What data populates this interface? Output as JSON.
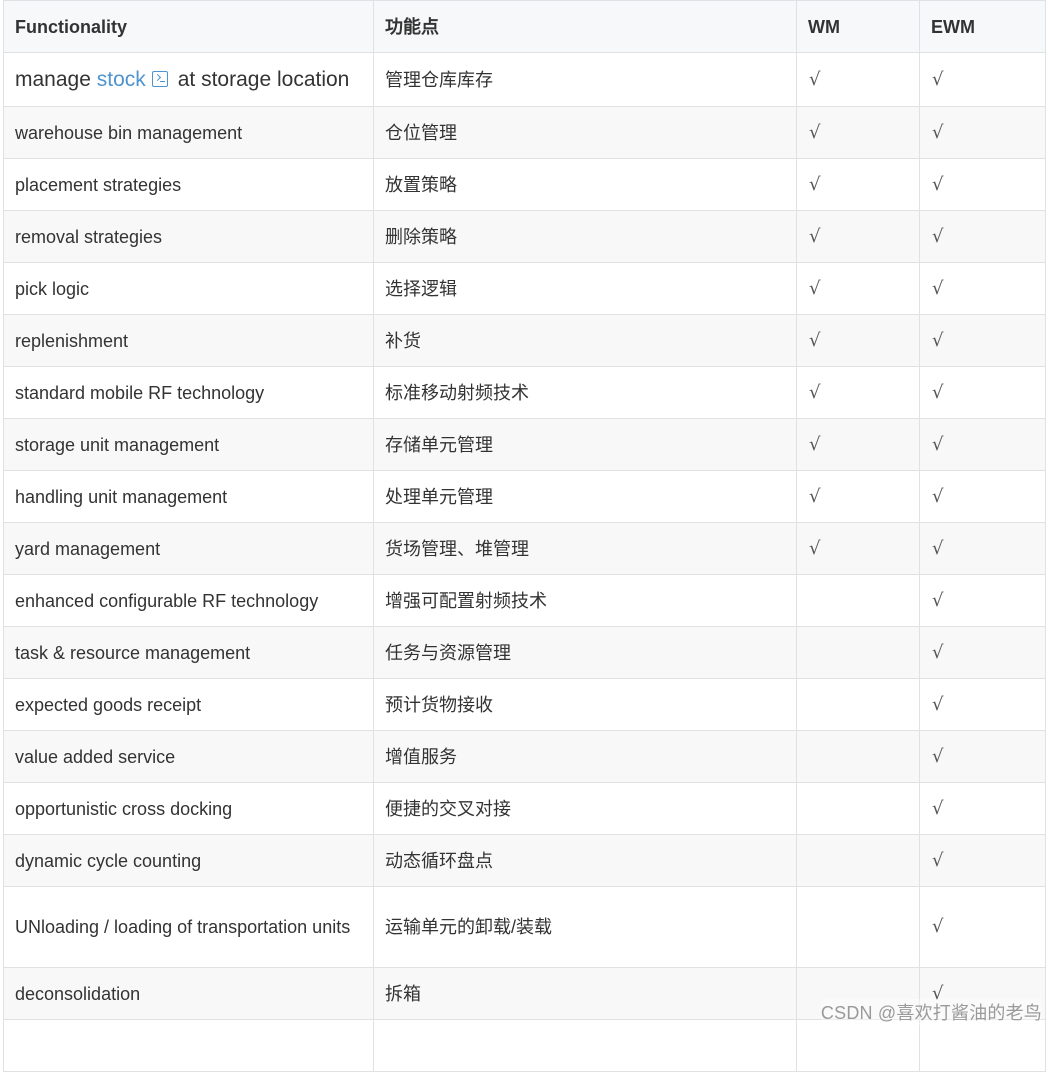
{
  "table": {
    "headers": [
      "Functionality",
      "功能点",
      "WM",
      "EWM"
    ],
    "first_row": {
      "func_before": "manage ",
      "func_link": "stock",
      "func_after": "at storage location",
      "zh": "管理仓库库存",
      "wm": "√",
      "ewm": "√"
    },
    "rows": [
      {
        "func": "warehouse bin management",
        "zh": "仓位管理",
        "wm": "√",
        "ewm": "√"
      },
      {
        "func": "placement strategies",
        "zh": "放置策略",
        "wm": "√",
        "ewm": "√"
      },
      {
        "func": "removal strategies",
        "zh": "删除策略",
        "wm": "√",
        "ewm": "√"
      },
      {
        "func": "pick logic",
        "zh": "选择逻辑",
        "wm": "√",
        "ewm": "√"
      },
      {
        "func": "replenishment",
        "zh": "补货",
        "wm": "√",
        "ewm": "√"
      },
      {
        "func": "standard mobile RF technology",
        "zh": "标准移动射频技术",
        "wm": "√",
        "ewm": "√"
      },
      {
        "func": "storage unit management",
        "zh": "存储单元管理",
        "wm": "√",
        "ewm": "√"
      },
      {
        "func": "handling unit management",
        "zh": "处理单元管理",
        "wm": "√",
        "ewm": "√"
      },
      {
        "func": "yard management",
        "zh": "货场管理、堆管理",
        "wm": "√",
        "ewm": "√"
      },
      {
        "func": "enhanced configurable RF technology",
        "zh": "增强可配置射频技术",
        "wm": "",
        "ewm": "√"
      },
      {
        "func": "task & resource management",
        "zh": "任务与资源管理",
        "wm": "",
        "ewm": "√"
      },
      {
        "func": "expected goods receipt",
        "zh": "预计货物接收",
        "wm": "",
        "ewm": "√"
      },
      {
        "func": "value added service",
        "zh": "增值服务",
        "wm": "",
        "ewm": "√"
      },
      {
        "func": "opportunistic cross docking",
        "zh": "便捷的交叉对接",
        "wm": "",
        "ewm": "√"
      },
      {
        "func": "dynamic cycle counting",
        "zh": "动态循环盘点",
        "wm": "",
        "ewm": "√"
      },
      {
        "func": "UNloading / loading of transportation units",
        "zh": "运输单元的卸载/装载",
        "wm": "",
        "ewm": "√",
        "tall": true
      },
      {
        "func": "deconsolidation",
        "zh": "拆箱",
        "wm": "",
        "ewm": "√"
      },
      {
        "func": "",
        "zh": "",
        "wm": "",
        "ewm": ""
      }
    ]
  },
  "watermark": "CSDN @喜欢打酱油的老鸟",
  "icons": {
    "inline_link_icon": "terminal-icon"
  },
  "colors": {
    "link": "#4e94ce",
    "header_bg": "#f6f8fa",
    "border": "#dfe2e5",
    "stripe": "#f8f8f8"
  }
}
